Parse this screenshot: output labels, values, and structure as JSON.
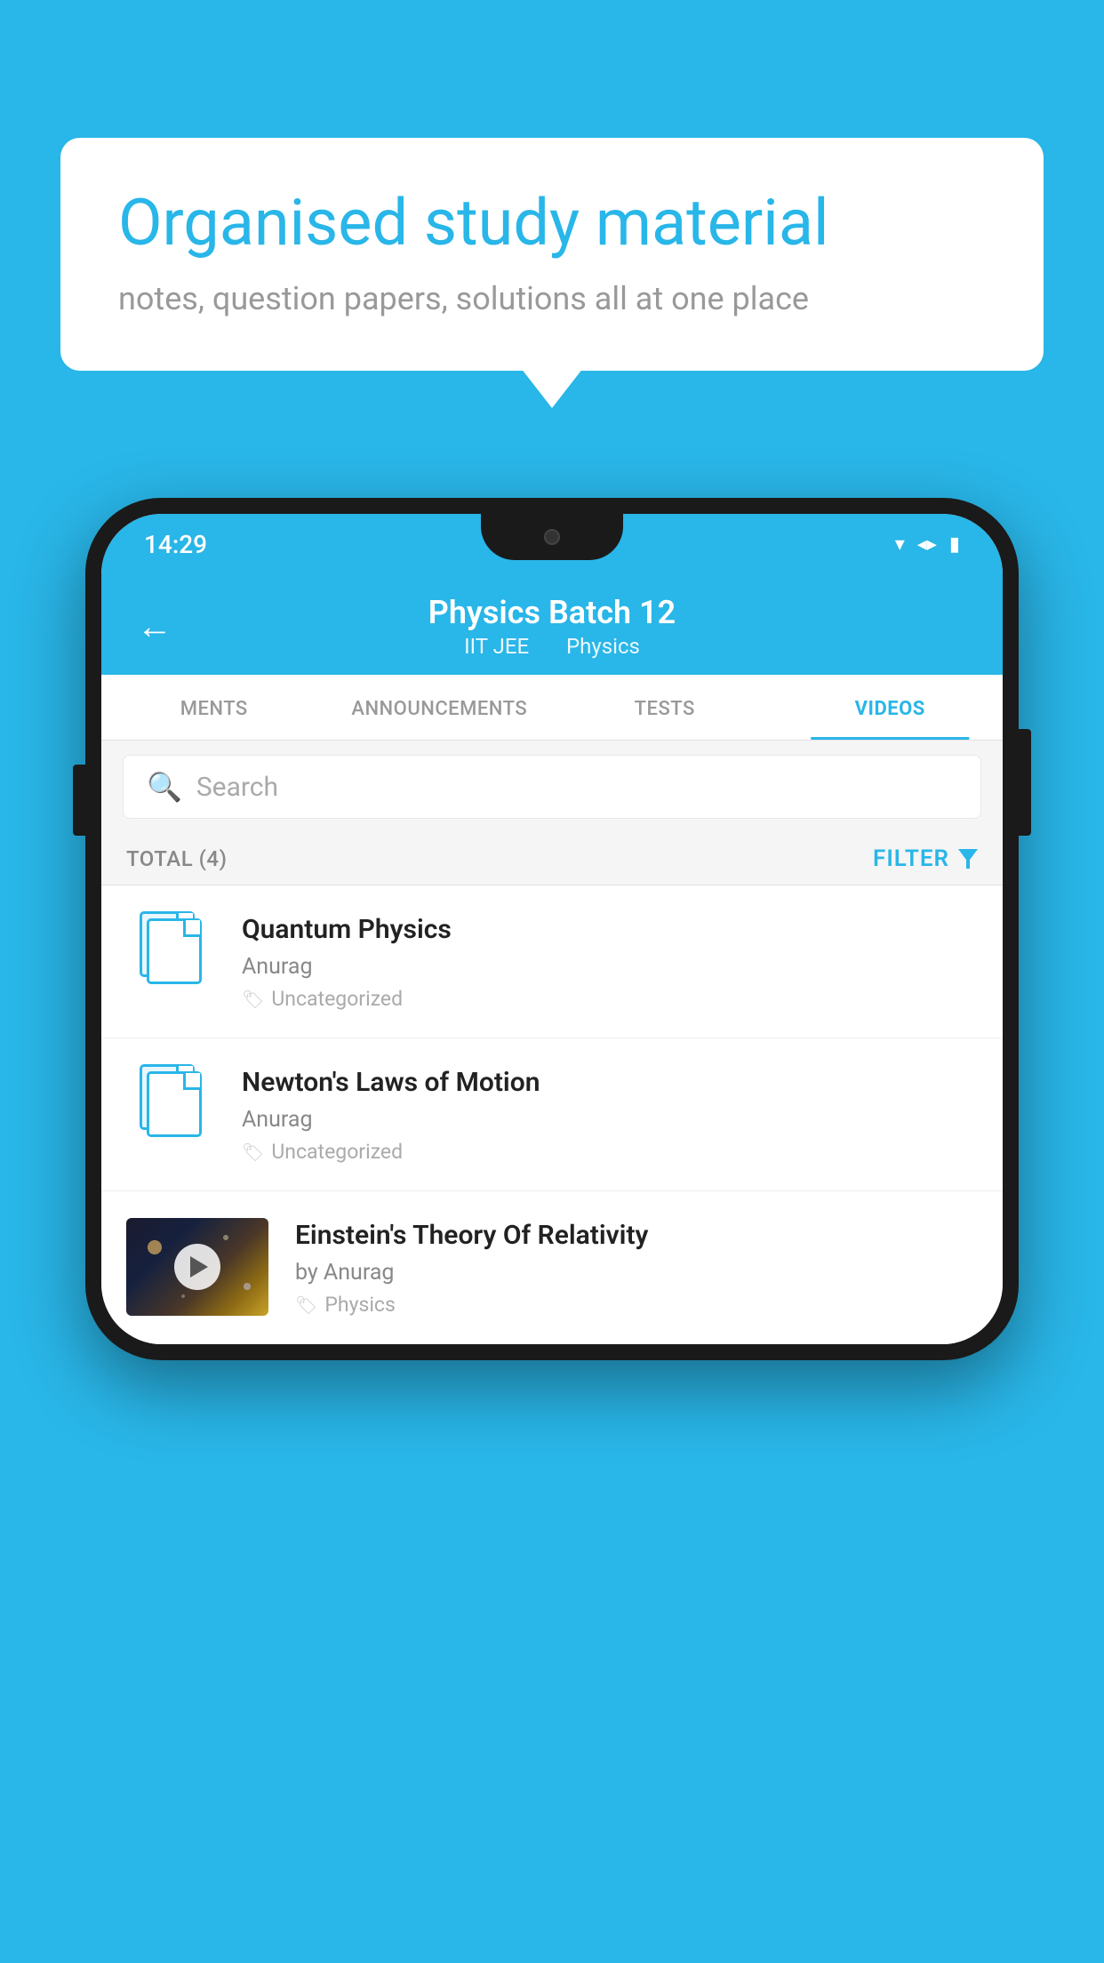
{
  "app": {
    "background_color": "#29b6e8"
  },
  "speech_bubble": {
    "heading": "Organised study material",
    "subtext": "notes, question papers, solutions all at one place"
  },
  "status_bar": {
    "time": "14:29",
    "wifi_icon": "wifi",
    "signal_icon": "signal",
    "battery_icon": "battery"
  },
  "app_header": {
    "back_label": "←",
    "title": "Physics Batch 12",
    "subtitle_part1": "IIT JEE",
    "subtitle_part2": "Physics"
  },
  "tabs": [
    {
      "label": "MENTS",
      "active": false
    },
    {
      "label": "ANNOUNCEMENTS",
      "active": false
    },
    {
      "label": "TESTS",
      "active": false
    },
    {
      "label": "VIDEOS",
      "active": true
    }
  ],
  "search": {
    "placeholder": "Search"
  },
  "filter_row": {
    "total_label": "TOTAL (4)",
    "filter_label": "FILTER"
  },
  "videos": [
    {
      "title": "Quantum Physics",
      "author": "Anurag",
      "tag": "Uncategorized",
      "has_thumbnail": false
    },
    {
      "title": "Newton's Laws of Motion",
      "author": "Anurag",
      "tag": "Uncategorized",
      "has_thumbnail": false
    },
    {
      "title": "Einstein's Theory Of Relativity",
      "author": "by Anurag",
      "tag": "Physics",
      "has_thumbnail": true
    }
  ]
}
